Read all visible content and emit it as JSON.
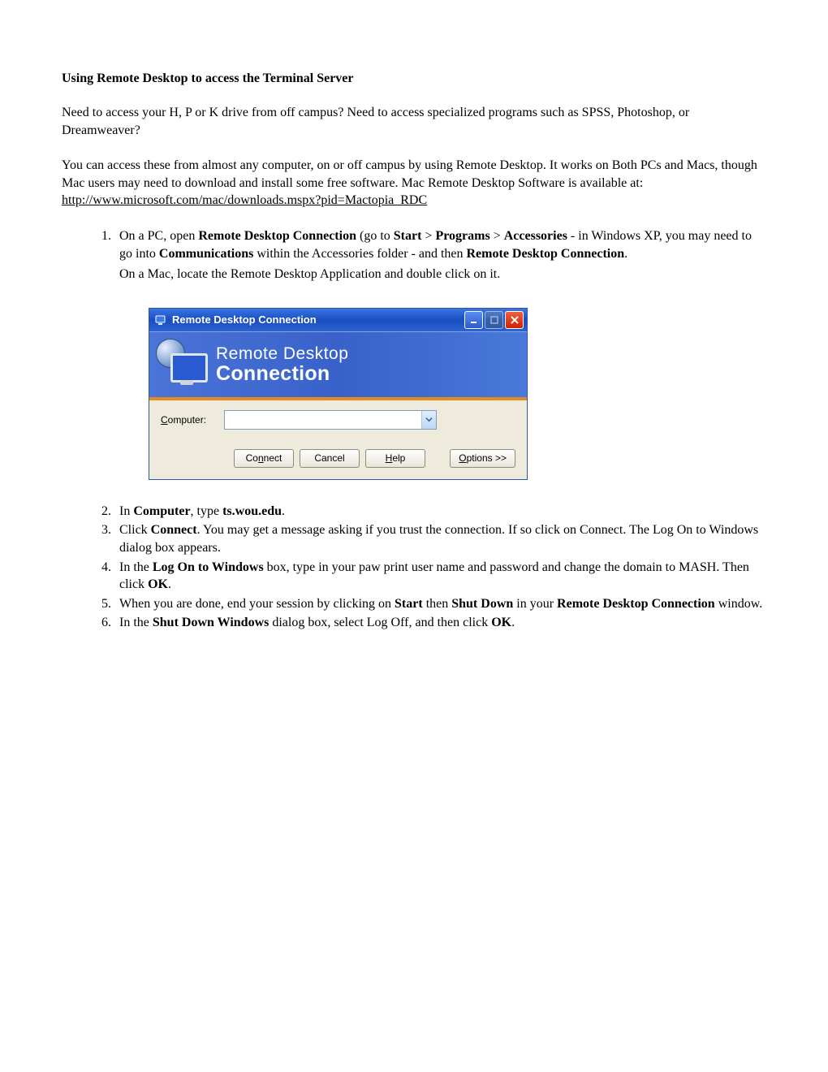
{
  "doc": {
    "title": "Using Remote Desktop to access the Terminal Server",
    "p1": "Need to access your H, P or K drive from off campus? Need to access specialized programs such as SPSS, Photoshop, or Dreamweaver?",
    "p2a": "You can access these from almost any computer, on or off campus by using Remote Desktop. It works on Both PCs and Macs, though Mac users may need to download and install some free software. Mac Remote Desktop Software is available at:",
    "p2_link": "http://www.microsoft.com/mac/downloads.mspx?pid=Mactopia_RDC",
    "step1": {
      "t1": "On a PC, open ",
      "b1": "Remote Desktop Connection",
      "t2": " (go to ",
      "b2": "Start",
      "t3": " > ",
      "b3": "Programs",
      "t4": " > ",
      "b4": "Accessories",
      "t5": " - in Windows XP, you may need to go into ",
      "b5": "Communications",
      "t6": " within the Accessories folder -  and then ",
      "b6": "Remote Desktop Connection",
      "t7": ".",
      "line2": "On a Mac, locate the Remote Desktop Application and double click on it."
    },
    "step2": {
      "t1": "In ",
      "b1": "Computer",
      "t2": ", type ",
      "b2": "ts.wou.edu",
      "t3": "."
    },
    "step3": {
      "t1": "Click ",
      "b1": "Connect",
      "t2": ". You may get a message asking if you trust the connection. If so click on Connect. The Log On to Windows dialog box appears."
    },
    "step4": {
      "t1": "In the ",
      "b1": "Log On to Windows",
      "t2": " box, type in your paw print user name and password and change the domain to MASH. Then click ",
      "b2": "OK",
      "t3": "."
    },
    "step5": {
      "t1": "When you are done, end your session by clicking on ",
      "b1": "Start",
      "t2": " then ",
      "b2": "Shut Down",
      "t3": " in your ",
      "b3": "Remote Desktop Connection",
      "t4": " window."
    },
    "step6": {
      "t1": "In the ",
      "b1": "Shut Down Windows",
      "t2": " dialog box, select Log Off, and then click ",
      "b2": "OK",
      "t3": "."
    }
  },
  "rdc": {
    "title": "Remote Desktop Connection",
    "banner_line1": "Remote Desktop",
    "banner_line2": "Connection",
    "computer_label_u": "C",
    "computer_label_rest": "omputer:",
    "computer_value": "",
    "btn_connect_u": "n",
    "btn_connect_pre": "Co",
    "btn_connect_post": "nect",
    "btn_cancel": "Cancel",
    "btn_help_u": "H",
    "btn_help_rest": "elp",
    "btn_options_u": "O",
    "btn_options_rest": "ptions >>"
  }
}
